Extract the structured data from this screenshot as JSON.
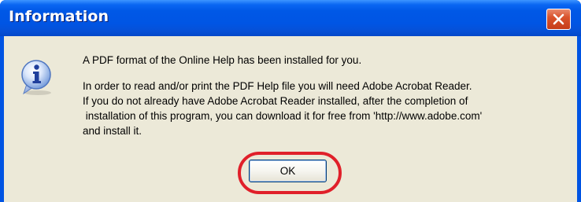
{
  "dialog": {
    "title": "Information",
    "icon": "information-icon",
    "message_lines": [
      "A PDF format of the Online Help has been installed for you.",
      "In order to read and/or print the PDF Help file you will need Adobe Acrobat Reader.",
      "If you do not already have Adobe Acrobat Reader installed, after the completion of",
      " installation of this program, you can download it for free from 'http://www.adobe.com'",
      "and install it."
    ],
    "ok_label": "OK"
  },
  "colors": {
    "titlebar": "#0055e4",
    "client_background": "#ece9d8",
    "close_button": "#d9532d",
    "highlight_annotation": "#e0202a"
  }
}
